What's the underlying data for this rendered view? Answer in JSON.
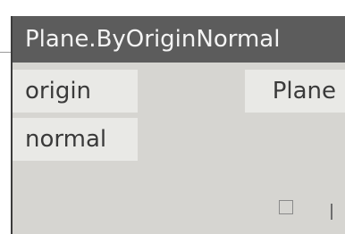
{
  "node": {
    "title": "Plane.ByOriginNormal",
    "inputs": [
      {
        "label": "origin"
      },
      {
        "label": "normal"
      }
    ],
    "output": {
      "label": "Plane"
    },
    "icons": {
      "preview_toggle": "checkbox-outline-icon",
      "resize_mark": "vertical-bar-icon"
    },
    "colors": {
      "header_bg": "#5c5c5c",
      "header_text": "#f4f4f4",
      "body_bg": "#d6d5d1",
      "port_bg": "#e9e9e6"
    }
  }
}
